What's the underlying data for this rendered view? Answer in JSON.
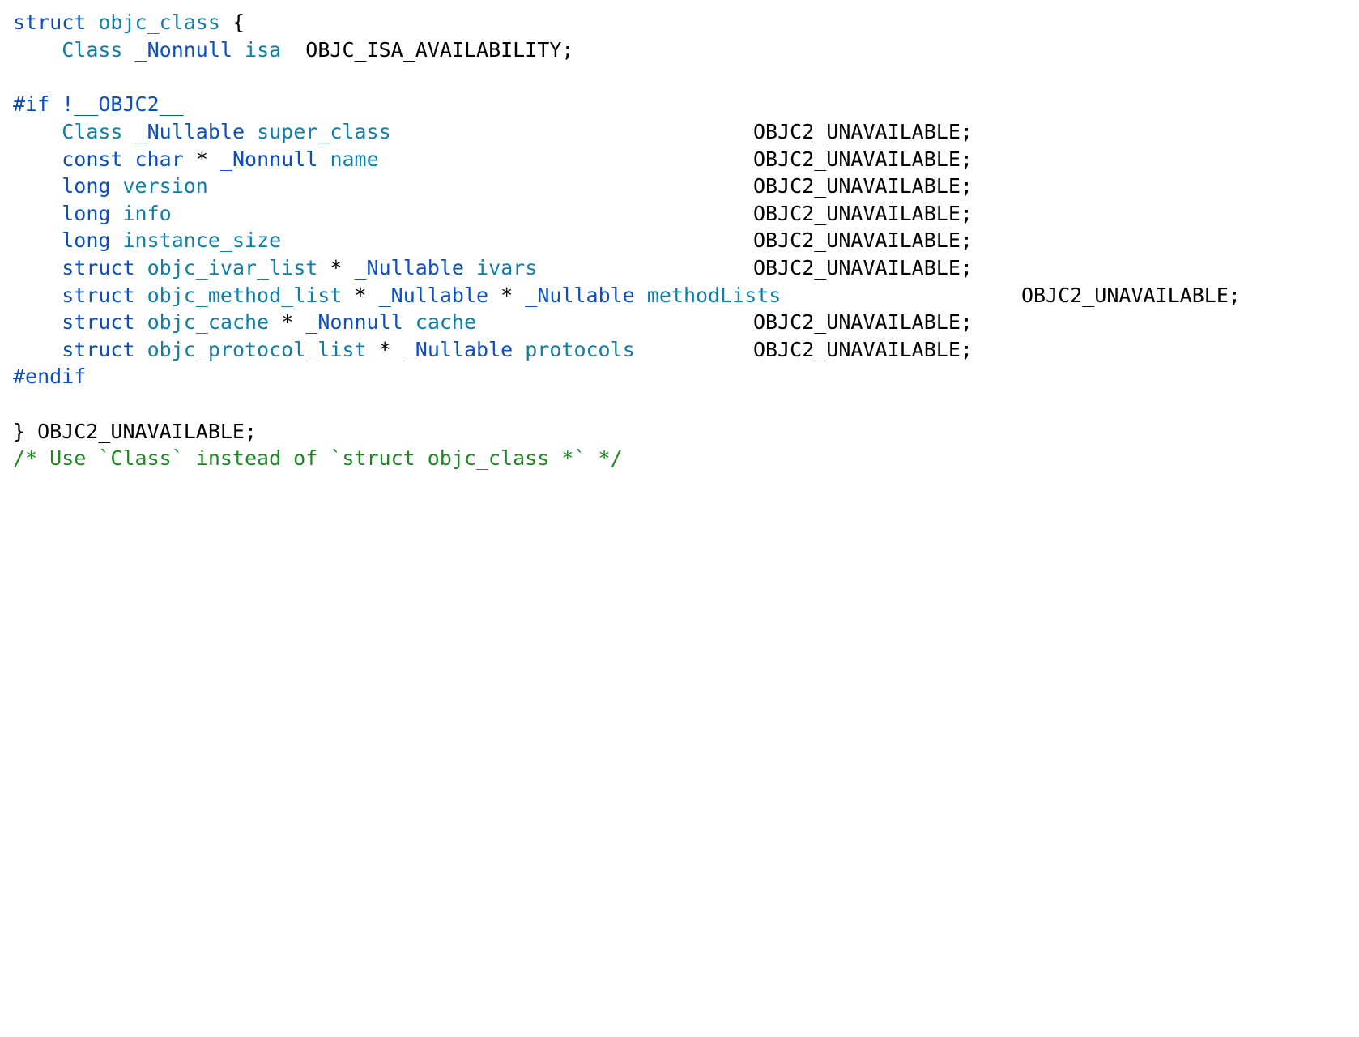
{
  "code": {
    "line1": {
      "kw": "struct",
      "name": "objc_class",
      "brace": "{"
    },
    "line2": {
      "type": "Class",
      "qual": "_Nonnull",
      "field": "isa",
      "macro": "OBJC_ISA_AVAILABILITY;"
    },
    "line4": {
      "directive": "#if !__OBJC2__"
    },
    "line5": {
      "type": "Class",
      "qual": "_Nullable",
      "field": "super_class",
      "macro": "OBJC2_UNAVAILABLE;"
    },
    "line6": {
      "kw": "const",
      "type": "char",
      "ptr": "*",
      "qual": "_Nonnull",
      "field": "name",
      "macro": "OBJC2_UNAVAILABLE;"
    },
    "line7": {
      "type": "long",
      "field": "version",
      "macro": "OBJC2_UNAVAILABLE;"
    },
    "line8": {
      "type": "long",
      "field": "info",
      "macro": "OBJC2_UNAVAILABLE;"
    },
    "line9": {
      "type": "long",
      "field": "instance_size",
      "macro": "OBJC2_UNAVAILABLE;"
    },
    "line10": {
      "kw": "struct",
      "type": "objc_ivar_list",
      "ptr": "*",
      "qual": "_Nullable",
      "field": "ivars",
      "macro": "OBJC2_UNAVAILABLE;"
    },
    "line11": {
      "kw": "struct",
      "type": "objc_method_list",
      "ptr1": "*",
      "qual1": "_Nullable",
      "ptr2": "*",
      "qual2": "_Nullable",
      "field": "methodLists",
      "macro": "OBJC2_UNAVAILABLE;"
    },
    "line12": {
      "kw": "struct",
      "type": "objc_cache",
      "ptr": "*",
      "qual": "_Nonnull",
      "field": "cache",
      "macro": "OBJC2_UNAVAILABLE;"
    },
    "line13": {
      "kw": "struct",
      "type": "objc_protocol_list",
      "ptr": "*",
      "qual": "_Nullable",
      "field": "protocols",
      "macro": "OBJC2_UNAVAILABLE;"
    },
    "line14": {
      "directive": "#endif"
    },
    "line16": {
      "text": "} OBJC2_UNAVAILABLE;"
    },
    "line17": {
      "comment": "/* Use `Class` instead of `struct objc_class *` */"
    }
  },
  "colors": {
    "keyword": "#0b4fc6",
    "type": "#0d7faa",
    "plain": "#000000",
    "comment": "#1b8a20"
  }
}
